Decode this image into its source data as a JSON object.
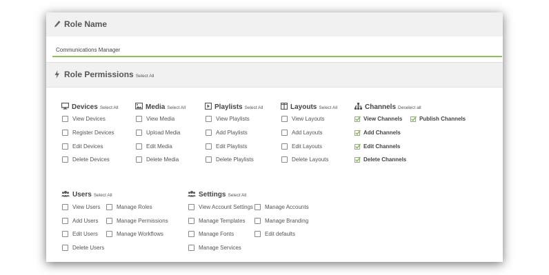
{
  "role_name": {
    "title": "Role Name",
    "value": "Communications Manager",
    "icon": "pencil-icon"
  },
  "permissions": {
    "title": "Role Permissions",
    "select_all": "Select All",
    "icon": "bolt-icon",
    "accent_color": "#8bc34a",
    "groups": {
      "devices": {
        "title": "Devices",
        "action": "Select All",
        "icon": "monitor-icon",
        "items": [
          {
            "label": "View Devices",
            "checked": false
          },
          {
            "label": "Register Devices",
            "checked": false
          },
          {
            "label": "Edit Devices",
            "checked": false
          },
          {
            "label": "Delete Devices",
            "checked": false
          }
        ]
      },
      "media": {
        "title": "Media",
        "action": "Select All",
        "icon": "image-icon",
        "items": [
          {
            "label": "View Media",
            "checked": false
          },
          {
            "label": "Upload Media",
            "checked": false
          },
          {
            "label": "Edit Media",
            "checked": false
          },
          {
            "label": "Delete Media",
            "checked": false
          }
        ]
      },
      "playlists": {
        "title": "Playlists",
        "action": "Select All",
        "icon": "play-square-icon",
        "items": [
          {
            "label": "View Playlists",
            "checked": false
          },
          {
            "label": "Add Playlists",
            "checked": false
          },
          {
            "label": "Edit Playlists",
            "checked": false
          },
          {
            "label": "Delete Playlists",
            "checked": false
          }
        ]
      },
      "layouts": {
        "title": "Layouts",
        "action": "Select All",
        "icon": "columns-icon",
        "items": [
          {
            "label": "View Layouts",
            "checked": false
          },
          {
            "label": "Add Layouts",
            "checked": false
          },
          {
            "label": "Edit Layouts",
            "checked": false
          },
          {
            "label": "Delete Layouts",
            "checked": false
          }
        ]
      },
      "channels": {
        "title": "Channels",
        "action": "Deselect all",
        "icon": "sitemap-icon",
        "items": [
          {
            "label": "View Channels",
            "checked": true
          },
          {
            "label": "Publish Channels",
            "checked": true
          },
          {
            "label": "Add Channels",
            "checked": true
          },
          {
            "label": "Edit Channels",
            "checked": true
          },
          {
            "label": "Delete Channels",
            "checked": true
          }
        ]
      },
      "users": {
        "title": "Users",
        "action": "Select All",
        "icon": "users-icon",
        "items": [
          {
            "label": "View Users",
            "checked": false
          },
          {
            "label": "Manage Roles",
            "checked": false
          },
          {
            "label": "Add Users",
            "checked": false
          },
          {
            "label": "Manage Permissions",
            "checked": false
          },
          {
            "label": "Edit Users",
            "checked": false
          },
          {
            "label": "Manage Workflows",
            "checked": false
          },
          {
            "label": "Delete Users",
            "checked": false
          }
        ]
      },
      "settings": {
        "title": "Settings",
        "action": "Select All",
        "icon": "users-icon",
        "items": [
          {
            "label": "View Account Settings",
            "checked": false
          },
          {
            "label": "Manage Accounts",
            "checked": false
          },
          {
            "label": "Manage Templates",
            "checked": false
          },
          {
            "label": "Manage Branding",
            "checked": false
          },
          {
            "label": "Manage Fonts",
            "checked": false
          },
          {
            "label": "Edit defaults",
            "checked": false
          },
          {
            "label": "Manage Services",
            "checked": false
          }
        ]
      }
    }
  }
}
